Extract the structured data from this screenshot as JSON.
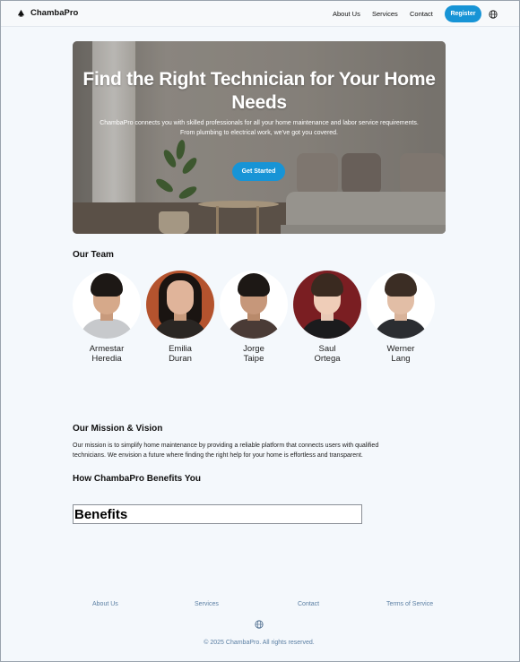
{
  "navbar": {
    "brand": "ChambaPro",
    "links": [
      "About Us",
      "Services",
      "Contact"
    ],
    "register_label": "Register",
    "icons": {
      "logo": "chambapro-logo-icon",
      "language": "globe-icon"
    }
  },
  "hero": {
    "title": "Find the Right Technician for Your Home Needs",
    "subtitle_line1": "ChambaPro connects you with skilled professionals for all your home maintenance and labor service requirements.",
    "subtitle_line2": "From plumbing to electrical work, we've got you covered.",
    "cta_label": "Get Started"
  },
  "team": {
    "heading": "Our Team",
    "members": [
      {
        "first": "Armestar",
        "last": "Heredia"
      },
      {
        "first": "Emilia",
        "last": "Duran"
      },
      {
        "first": "Jorge",
        "last": "Taipe"
      },
      {
        "first": "Saul",
        "last": "Ortega"
      },
      {
        "first": "Werner",
        "last": "Lang"
      }
    ]
  },
  "mission": {
    "heading": "Our Mission & Vision",
    "line1": "Our mission is to simplify home maintenance by providing a reliable platform that connects users with qualified",
    "line2": "technicians. We envision a future where finding the right help for your home is effortless and transparent."
  },
  "benefits": {
    "heading": "How ChambaPro Benefits You",
    "box_label": "Benefits"
  },
  "footer": {
    "links": [
      "About Us",
      "Services",
      "Contact",
      "Terms of Service"
    ],
    "copyright": "© 2025 ChambaPro. All rights reserved."
  },
  "colors": {
    "accent": "#1794d6",
    "page_bg": "#f4f8fc",
    "footer_text": "#5b7fa3"
  }
}
